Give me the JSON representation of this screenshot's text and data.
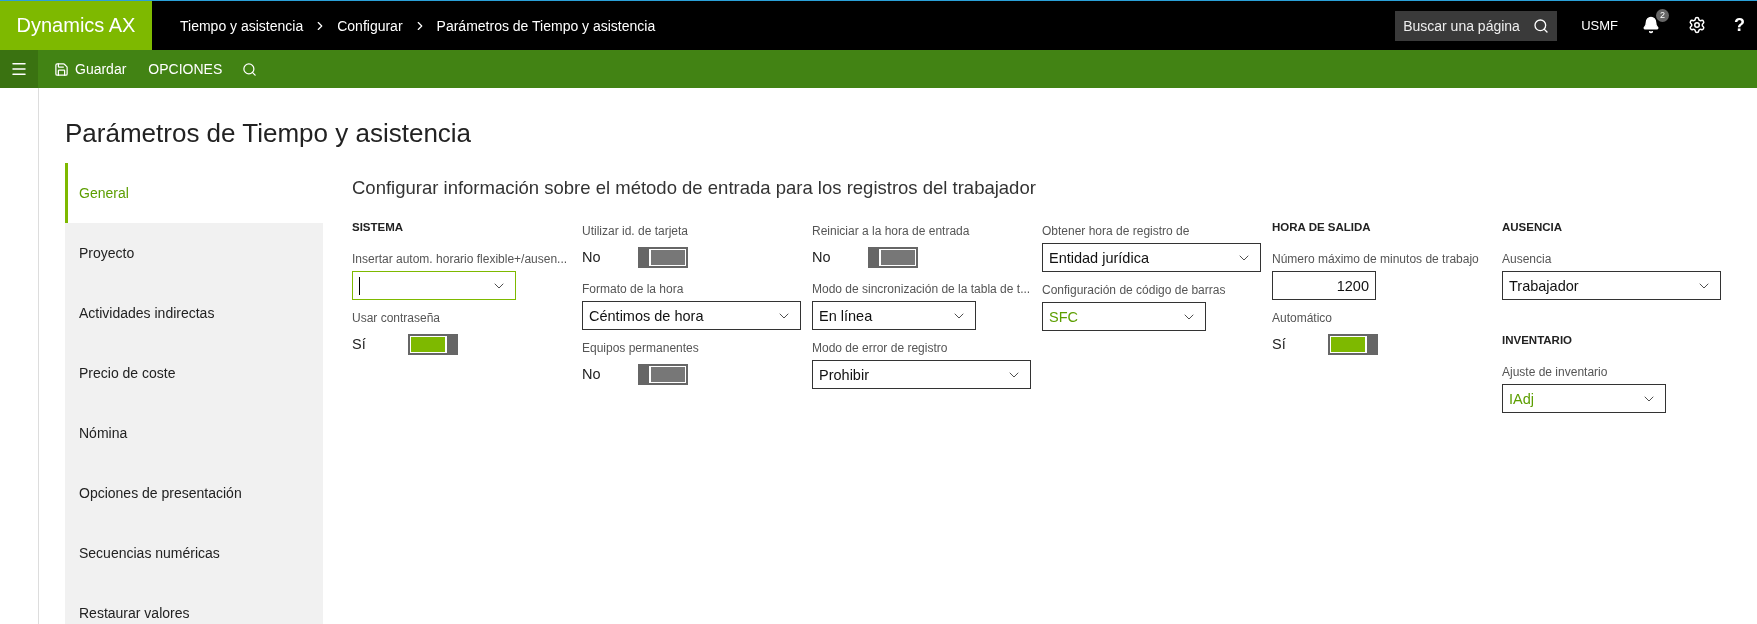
{
  "app": {
    "name": "Dynamics AX"
  },
  "breadcrumb": [
    "Tiempo y asistencia",
    "Configurar",
    "Parámetros de Tiempo y asistencia"
  ],
  "search": {
    "placeholder": "Buscar una página"
  },
  "company": "USMF",
  "notifications": {
    "count": "2"
  },
  "help": "?",
  "action_bar": {
    "save": "Guardar",
    "options": "OPCIONES"
  },
  "page_title": "Parámetros de Tiempo y asistencia",
  "nav": [
    {
      "label": "General",
      "selected": true
    },
    {
      "label": "Proyecto",
      "selected": false
    },
    {
      "label": "Actividades indirectas",
      "selected": false
    },
    {
      "label": "Precio de coste",
      "selected": false
    },
    {
      "label": "Nómina",
      "selected": false
    },
    {
      "label": "Opciones de presentación",
      "selected": false
    },
    {
      "label": "Secuencias numéricas",
      "selected": false
    },
    {
      "label": "Restaurar valores",
      "selected": false
    }
  ],
  "section_title": "Configurar información sobre el método de entrada para los registros del trabajador",
  "columns": [
    {
      "items": [
        {
          "kind": "heading",
          "label": "SISTEMA"
        },
        {
          "kind": "dropdown",
          "label": "Insertar autom. horario flexible+/ausen...",
          "focused": true
        },
        {
          "kind": "toggle",
          "label": "Usar contraseña",
          "value": "Sí",
          "on": true
        }
      ]
    },
    {
      "items": [
        {
          "kind": "toggle",
          "label": "Utilizar id. de tarjeta",
          "value": "No",
          "on": false
        },
        {
          "kind": "dropdown",
          "label": "Formato de la hora",
          "value": "Céntimos de hora",
          "focused": false
        },
        {
          "kind": "toggle",
          "label": "Equipos permanentes",
          "value": "No",
          "on": false
        }
      ]
    },
    {
      "items": [
        {
          "kind": "toggle",
          "label": "Reiniciar a la hora de entrada",
          "value": "No",
          "on": false
        },
        {
          "kind": "dropdown",
          "label": "Modo de sincronización de la tabla de t...",
          "value": "En línea",
          "focused": false
        },
        {
          "kind": "dropdown",
          "label": "Modo de error de registro",
          "value": "Prohibir",
          "focused": false
        }
      ]
    },
    {
      "items": [
        {
          "kind": "dropdown",
          "label": "Obtener hora de registro de",
          "value": "Entidad jurídica",
          "focused": false
        },
        {
          "kind": "dropdown",
          "label": "Configuración de código de barras",
          "value": "SFC",
          "focused": false,
          "linked": true
        }
      ]
    },
    {
      "items": [
        {
          "kind": "heading",
          "label": "HORA DE SALIDA"
        },
        {
          "kind": "number",
          "label": "Número máximo de minutos de trabajo",
          "value": "1200"
        },
        {
          "kind": "toggle",
          "label": "Automático",
          "value": "Sí",
          "on": true
        }
      ]
    },
    {
      "items": [
        {
          "kind": "heading",
          "label": "AUSENCIA"
        },
        {
          "kind": "dropdown",
          "label": "Ausencia",
          "value": "Trabajador",
          "focused": false
        },
        {
          "kind": "heading",
          "label": "INVENTARIO"
        },
        {
          "kind": "dropdown",
          "label": "Ajuste de inventario",
          "value": "IAdj",
          "focused": false,
          "linked": true
        }
      ]
    }
  ]
}
